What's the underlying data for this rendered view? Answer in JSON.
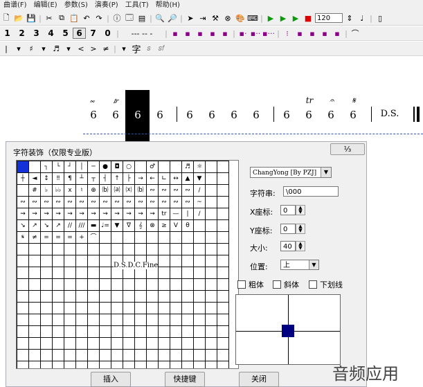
{
  "menu": [
    "曲谱(F)",
    "编辑(E)",
    "参数(S)",
    "演奏(P)",
    "工具(T)",
    "帮助(H)"
  ],
  "toolbar1": {
    "tempo": "120"
  },
  "toolbar2": {
    "digits": [
      "1",
      "2",
      "3",
      "4",
      "5",
      "6",
      "7",
      "0"
    ],
    "dashes": "--- -- -"
  },
  "toolbar3": {
    "char": "字"
  },
  "score": {
    "notes": [
      "6",
      "6",
      "6",
      "6",
      "6",
      "6",
      "6",
      "6",
      "6",
      "6",
      "6",
      "6"
    ],
    "ornaments": [
      "𝆗",
      "𝆖",
      "tr",
      "𝄐",
      "𝄋"
    ],
    "ds_label": "D.S."
  },
  "dialog": {
    "title": "字符装饰（仅限专业版）",
    "close_label": "⅓",
    "font_select": "ChangYong [By PZJ]",
    "glyph_string_label": "字符串:",
    "glyph_string_value": "\\000",
    "x_label": "X座标:",
    "x_value": "0",
    "y_label": "Y座标:",
    "y_value": "0",
    "size_label": "大小:",
    "size_value": "40",
    "position_label": "位置:",
    "position_value": "上",
    "bold_label": "粗体",
    "italic_label": "斜体",
    "underline_label": "下划线",
    "insert_button": "插入",
    "shortcut_button": "快捷键",
    "close_button": "关闭",
    "grid_text": "D.S.D.C.Fine",
    "glyph_rows": [
      [
        "",
        "",
        "┐",
        "└",
        "┘",
        "│",
        "─",
        "●",
        "◘",
        "○",
        "",
        "♂",
        "",
        "",
        "♬",
        "☼"
      ],
      [
        "┼",
        "◄",
        "↕",
        "‼",
        "¶",
        "┴",
        "┬",
        "┤",
        "↑",
        "├",
        "→",
        "←",
        "∟",
        "↔",
        "▲",
        "▼"
      ],
      [
        "",
        "#",
        "♭",
        "♭♭",
        "x",
        "♮",
        "⊕",
        "⒝",
        "⒜",
        "⒳",
        "⒝",
        "∾",
        "∾",
        "∾",
        "∾",
        "/"
      ],
      [
        "∾",
        "∾",
        "∾",
        "∾",
        "∾",
        "∾",
        "∾",
        "∾",
        "∾",
        "∾",
        "∾",
        "∾",
        "∾",
        "∾",
        "∾",
        "~"
      ],
      [
        "⇝",
        "⇝",
        "⇝",
        "⇝",
        "⇝",
        "⇝",
        "⇝",
        "⇝",
        "⇝",
        "⇝",
        "⇝",
        "⇝",
        "tr",
        "—",
        "|",
        "/"
      ],
      [
        "↘",
        "↗",
        "↘",
        "↗",
        "//",
        "///",
        "▬",
        "♩=",
        "▼",
        "∇",
        "𝄞",
        "⊗",
        "≥",
        "V",
        "θ",
        ""
      ],
      [
        "𝄋",
        "≠",
        "=",
        "=",
        "=",
        "+",
        "⌒",
        "",
        "",
        "",
        "",
        "",
        "",
        "",
        "",
        ""
      ]
    ]
  },
  "watermark": "音频应用"
}
